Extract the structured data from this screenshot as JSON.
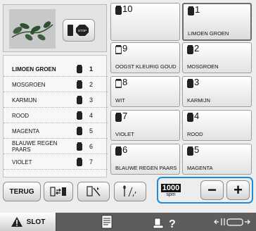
{
  "preview": {
    "stop_icon": "stop-icon",
    "stop_text": "STOP"
  },
  "sequence": [
    {
      "name": "LIMOEN GROEN",
      "number": "1",
      "active": true
    },
    {
      "name": "MOSGROEN",
      "number": "2"
    },
    {
      "name": "KARMIJN",
      "number": "3"
    },
    {
      "name": "ROOD",
      "number": "4"
    },
    {
      "name": "MAGENTA",
      "number": "5"
    },
    {
      "name": "BLAUWE REGEN PAARS",
      "number": "6"
    },
    {
      "name": "VIOLET",
      "number": "7"
    }
  ],
  "needles": {
    "n10": {
      "number": "10",
      "name": ""
    },
    "n1": {
      "number": "1",
      "name": "LIMOEN GROEN"
    },
    "n9": {
      "number": "9",
      "name": "OOGST KLEURIG GOUD"
    },
    "n2": {
      "number": "2",
      "name": "MOSGROEN"
    },
    "n8": {
      "number": "8",
      "name": "WIT"
    },
    "n3": {
      "number": "3",
      "name": "KARMIJN"
    },
    "n7": {
      "number": "7",
      "name": "VIOLET"
    },
    "n4": {
      "number": "4",
      "name": "ROOD"
    },
    "n6": {
      "number": "6",
      "name": "BLAUWE REGEN PAARS"
    },
    "n5": {
      "number": "5",
      "name": "MAGENTA"
    }
  },
  "toolbar": {
    "back_label": "TERUG",
    "speed_value": "1000",
    "speed_unit": "spm",
    "minus_label": "−",
    "plus_label": "+"
  },
  "statusbar": {
    "lock_label": "SLOT"
  },
  "colors": {
    "highlight": "#1d8dd8",
    "leaf": "#2e4f32",
    "status_bar": "#5d5d5d"
  }
}
